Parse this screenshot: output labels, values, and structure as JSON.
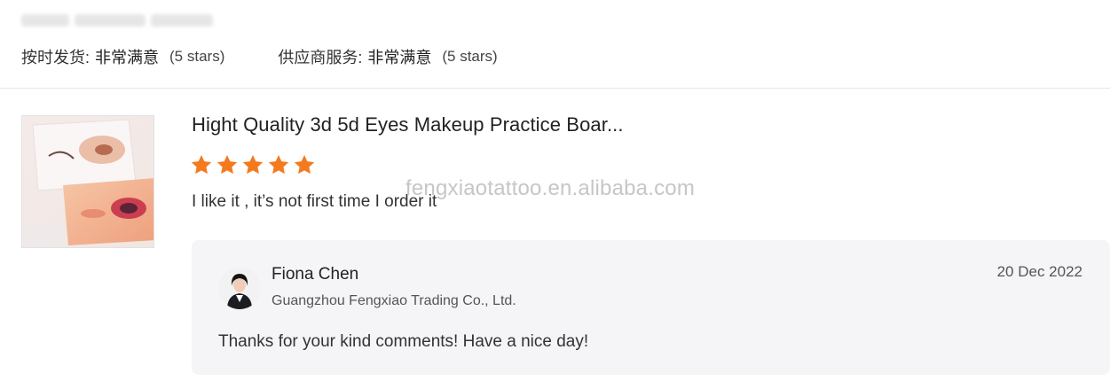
{
  "ratings": [
    {
      "label": "按时发货:",
      "value": "非常满意",
      "stars": "(5 stars)"
    },
    {
      "label": "供应商服务:",
      "value": "非常满意",
      "stars": "(5 stars)"
    }
  ],
  "review": {
    "product_title": "Hight Quality 3d 5d Eyes Makeup Practice Boar...",
    "rating": 5,
    "text": "I like it , it’s not first time I order it"
  },
  "watermark": "fengxiaotattoo.en.alibaba.com",
  "reply": {
    "seller_name": "Fiona Chen",
    "company": "Guangzhou Fengxiao Trading Co., Ltd.",
    "date": "20 Dec 2022",
    "text": "Thanks for your kind comments! Have a nice day!"
  },
  "colors": {
    "star": "#f47a1f",
    "reply_bg": "#f5f5f7"
  }
}
